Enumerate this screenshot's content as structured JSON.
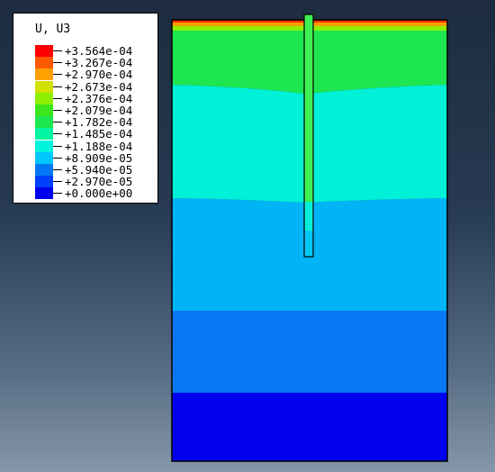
{
  "legend": {
    "title": "U, U3",
    "labels": [
      "+3.564e-04",
      "+3.267e-04",
      "+2.970e-04",
      "+2.673e-04",
      "+2.376e-04",
      "+2.079e-04",
      "+1.782e-04",
      "+1.485e-04",
      "+1.188e-04",
      "+8.909e-05",
      "+5.940e-05",
      "+2.970e-05",
      "+0.000e+00"
    ],
    "colors": [
      "#ff0000",
      "#ff5a00",
      "#ffa000",
      "#d2e000",
      "#8cf000",
      "#3ce61e",
      "#1ee650",
      "#00f5a0",
      "#00f5dc",
      "#00c8ff",
      "#0078f5",
      "#0040ff",
      "#0000f0"
    ]
  },
  "contour_colors": {
    "top_strip": "#ff3000",
    "band_green": "#1ee650",
    "band_cyan": "#00f0d8",
    "band_sky": "#00b4f5",
    "band_blue": "#0a78f5",
    "band_deep": "#0000ee",
    "pile": "#3cf050"
  }
}
